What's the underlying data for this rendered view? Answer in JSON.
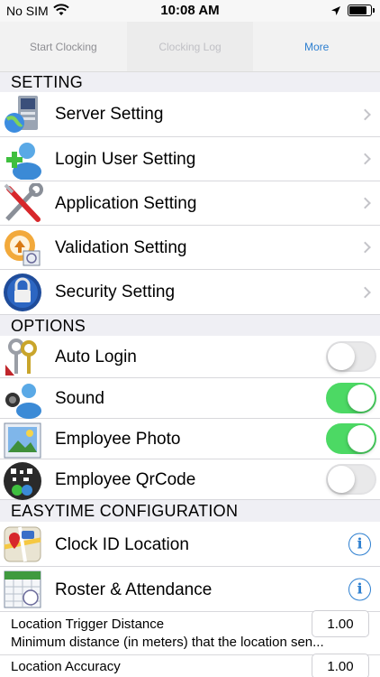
{
  "status_bar": {
    "carrier": "No SIM",
    "time": "10:08 AM",
    "battery_level": 0.85
  },
  "tabs": [
    {
      "label": "Start Clocking",
      "state": "inactive"
    },
    {
      "label": "Clocking Log",
      "state": "disabled"
    },
    {
      "label": "More",
      "state": "active"
    }
  ],
  "sections": {
    "setting": "SETTING",
    "options": "OPTIONS",
    "easytime": "EASYTIME CONFIGURATION"
  },
  "settings": [
    {
      "label": "Server Setting",
      "icon": "server-icon"
    },
    {
      "label": "Login User Setting",
      "icon": "add-user-icon"
    },
    {
      "label": "Application Setting",
      "icon": "tools-icon"
    },
    {
      "label": "Validation Setting",
      "icon": "validation-icon"
    },
    {
      "label": "Security Setting",
      "icon": "lock-icon"
    }
  ],
  "options": [
    {
      "label": "Auto Login",
      "icon": "keys-icon",
      "on": false
    },
    {
      "label": "Sound",
      "icon": "speaker-user-icon",
      "on": true
    },
    {
      "label": "Employee Photo",
      "icon": "photo-icon",
      "on": true
    },
    {
      "label": "Employee QrCode",
      "icon": "qrcode-icon",
      "on": false
    }
  ],
  "easytime": [
    {
      "label": "Clock ID Location",
      "icon": "map-icon"
    },
    {
      "label": "Roster & Attendance",
      "icon": "calendar-icon"
    }
  ],
  "fields": [
    {
      "label": "Location Trigger Distance",
      "description": "Minimum distance (in meters) that the location sen...",
      "value": "1.00"
    },
    {
      "label": "Location Accuracy",
      "value": "1.00"
    }
  ],
  "colors": {
    "accent": "#2d7fd0",
    "toggle_on": "#4cd964"
  }
}
